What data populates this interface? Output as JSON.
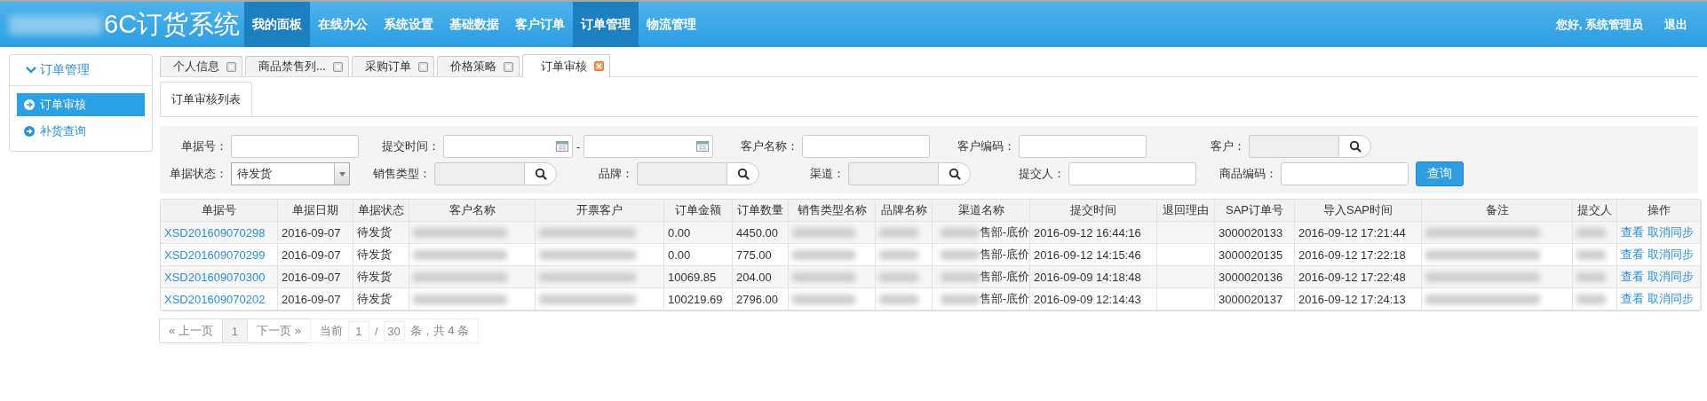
{
  "header": {
    "logo": "6C订货系统",
    "nav": [
      {
        "label": "我的面板",
        "selected": true
      },
      {
        "label": "在线办公",
        "selected": false
      },
      {
        "label": "系统设置",
        "selected": false
      },
      {
        "label": "基础数据",
        "selected": false
      },
      {
        "label": "客户订单",
        "selected": false
      },
      {
        "label": "订单管理",
        "selected": true
      },
      {
        "label": "物流管理",
        "selected": false
      }
    ],
    "greeting": "您好, 系统管理员",
    "logout": "退出"
  },
  "sidebar": {
    "group": {
      "label": "订单管理",
      "expanded": true
    },
    "items": [
      {
        "label": "订单审核",
        "selected": true
      },
      {
        "label": "补货查询",
        "selected": false
      }
    ]
  },
  "tabs": [
    {
      "label": "个人信息",
      "selected": false
    },
    {
      "label": "商品禁售列...",
      "selected": false
    },
    {
      "label": "采购订单",
      "selected": false
    },
    {
      "label": "价格策略",
      "selected": false
    },
    {
      "label": "订单审核",
      "selected": true
    }
  ],
  "subtab": "订单审核列表",
  "filters": [
    {
      "kind": "text",
      "label": "单据号："
    },
    {
      "kind": "daterange",
      "label": "提交时间：",
      "separator": "-"
    },
    {
      "kind": "text",
      "label": "客户名称："
    },
    {
      "kind": "text",
      "label": "客户编码："
    },
    {
      "kind": "lookup",
      "label": "客户："
    },
    {
      "kind": "select",
      "label": "单据状态：",
      "value": "待发货"
    },
    {
      "kind": "lookup",
      "label": "销售类型："
    },
    {
      "kind": "lookup",
      "label": "品牌："
    },
    {
      "kind": "lookup",
      "label": "渠道："
    },
    {
      "kind": "text",
      "label": "提交人："
    },
    {
      "kind": "text",
      "label": "商品编码："
    }
  ],
  "query_button": "查询",
  "table": {
    "columns": [
      "单据号",
      "单据日期",
      "单据状态",
      "客户名称",
      "开票客户",
      "订单金额",
      "订单数量",
      "销售类型名称",
      "品牌名称",
      "渠道名称",
      "提交时间",
      "退回理由",
      "SAP订单号",
      "导入SAP时间",
      "备注",
      "提交人",
      "操作"
    ],
    "rows": [
      {
        "cells": [
          {
            "kind": "link",
            "text": "XSD201609070298"
          },
          {
            "kind": "text",
            "text": "2016-09-07"
          },
          {
            "kind": "text",
            "text": "待发货"
          },
          {
            "kind": "blurred"
          },
          {
            "kind": "blurred"
          },
          {
            "kind": "text",
            "text": "0.00"
          },
          {
            "kind": "text",
            "text": "4450.00"
          },
          {
            "kind": "blurred"
          },
          {
            "kind": "blurred"
          },
          {
            "kind": "partial",
            "text": "售部-底价"
          },
          {
            "kind": "text",
            "text": "2016-09-12 16:44:16"
          },
          {
            "kind": "empty"
          },
          {
            "kind": "text",
            "text": "3000020133"
          },
          {
            "kind": "text",
            "text": "2016-09-12 17:21:44"
          },
          {
            "kind": "blurred"
          },
          {
            "kind": "blurred"
          },
          {
            "kind": "actions",
            "links": [
              "查看",
              "取消同步"
            ]
          }
        ]
      },
      {
        "cells": [
          {
            "kind": "link",
            "text": "XSD201609070299"
          },
          {
            "kind": "text",
            "text": "2016-09-07"
          },
          {
            "kind": "text",
            "text": "待发货"
          },
          {
            "kind": "blurred"
          },
          {
            "kind": "blurred"
          },
          {
            "kind": "text",
            "text": "0.00"
          },
          {
            "kind": "text",
            "text": "775.00"
          },
          {
            "kind": "blurred"
          },
          {
            "kind": "blurred"
          },
          {
            "kind": "partial",
            "text": "售部-底价"
          },
          {
            "kind": "text",
            "text": "2016-09-12 14:15:46"
          },
          {
            "kind": "empty"
          },
          {
            "kind": "text",
            "text": "3000020135"
          },
          {
            "kind": "text",
            "text": "2016-09-12 17:22:18"
          },
          {
            "kind": "blurred"
          },
          {
            "kind": "blurred"
          },
          {
            "kind": "actions",
            "links": [
              "查看",
              "取消同步"
            ]
          }
        ]
      },
      {
        "cells": [
          {
            "kind": "link",
            "text": "XSD201609070300"
          },
          {
            "kind": "text",
            "text": "2016-09-07"
          },
          {
            "kind": "text",
            "text": "待发货"
          },
          {
            "kind": "blurred"
          },
          {
            "kind": "blurred"
          },
          {
            "kind": "text",
            "text": "10069.85"
          },
          {
            "kind": "text",
            "text": "204.00"
          },
          {
            "kind": "blurred"
          },
          {
            "kind": "blurred"
          },
          {
            "kind": "partial",
            "text": "售部-底价"
          },
          {
            "kind": "text",
            "text": "2016-09-09 14:18:48"
          },
          {
            "kind": "empty"
          },
          {
            "kind": "text",
            "text": "3000020136"
          },
          {
            "kind": "text",
            "text": "2016-09-12 17:22:48"
          },
          {
            "kind": "blurred"
          },
          {
            "kind": "blurred"
          },
          {
            "kind": "actions",
            "links": [
              "查看",
              "取消同步"
            ]
          }
        ]
      },
      {
        "cells": [
          {
            "kind": "link",
            "text": "XSD201609070202"
          },
          {
            "kind": "text",
            "text": "2016-09-07"
          },
          {
            "kind": "text",
            "text": "待发货"
          },
          {
            "kind": "blurred"
          },
          {
            "kind": "blurred"
          },
          {
            "kind": "text",
            "text": "100219.69"
          },
          {
            "kind": "text",
            "text": "2796.00"
          },
          {
            "kind": "blurred"
          },
          {
            "kind": "blurred"
          },
          {
            "kind": "partial",
            "text": "售部-底价"
          },
          {
            "kind": "text",
            "text": "2016-09-09 12:14:43"
          },
          {
            "kind": "empty"
          },
          {
            "kind": "text",
            "text": "3000020137"
          },
          {
            "kind": "text",
            "text": "2016-09-12 17:24:13"
          },
          {
            "kind": "blurred"
          },
          {
            "kind": "blurred"
          },
          {
            "kind": "actions",
            "links": [
              "查看",
              "取消同步"
            ]
          }
        ]
      }
    ]
  },
  "pagination": {
    "prev": "« 上一页",
    "page": "1",
    "next": "下一页 »",
    "current_label": "当前",
    "current_page": "1",
    "slash": "/",
    "page_size": "30",
    "summary": "条，共 4 条"
  }
}
